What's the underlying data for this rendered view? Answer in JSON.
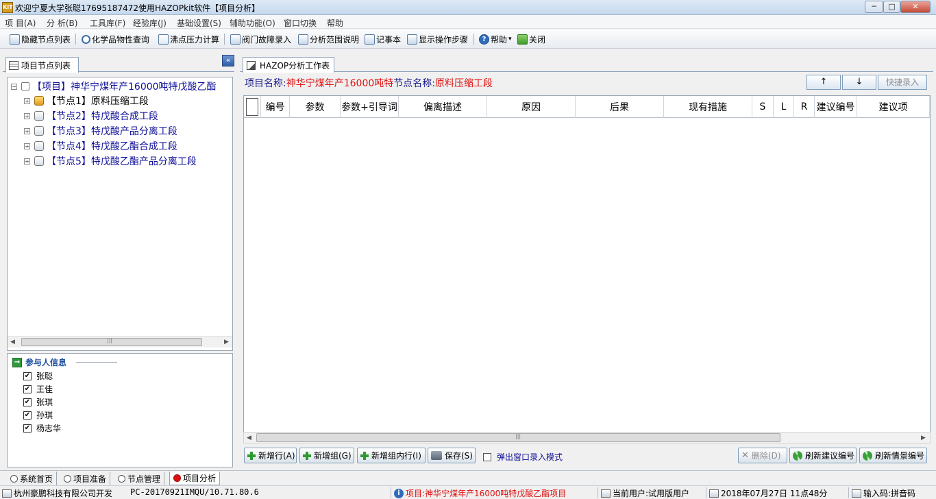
{
  "window": {
    "title": "欢迎宁夏大学张聪17695187472使用HAZOPkit软件【项目分析】",
    "app_icon_text": "KIT",
    "controls": {
      "minimize": "─",
      "maximize": "□",
      "close": "✕"
    }
  },
  "menubar": [
    "项 目(A)",
    "分 析(B)",
    "工具库(F)",
    "经验库(J)",
    "基础设置(S)",
    "辅助功能(O)",
    "窗口切换",
    "帮助"
  ],
  "toolbar": {
    "hide_tree": "隐藏节点列表",
    "chem_query": "化学品物性查询",
    "boiling_calc": "沸点压力计算",
    "valve_fault": "阀门故障录入",
    "scope_desc": "分析范围说明",
    "notepad": "记事本",
    "show_steps": "显示操作步骤",
    "help": "帮助",
    "help_arrow": "▾",
    "close": "关闭"
  },
  "left_panel": {
    "tab_label": "项目节点列表",
    "collapse_symbol": "«",
    "tree": {
      "project": "【项目】神华宁煤年产16000吨特戊酸乙酯",
      "nodes": [
        {
          "label": "【节点1】原料压缩工段",
          "active": true
        },
        {
          "label": "【节点2】特戊酸合成工段",
          "active": false
        },
        {
          "label": "【节点3】特戊酸产品分离工段",
          "active": false
        },
        {
          "label": "【节点4】特戊酸乙酯合成工段",
          "active": false
        },
        {
          "label": "【节点5】特戊酸乙酯产品分离工段",
          "active": false
        }
      ],
      "expander": "⊞",
      "root_expander": "⊟"
    },
    "scroll": {
      "left": "◀",
      "right": "▶",
      "grip": "|||"
    },
    "participants": {
      "title": "参与人信息",
      "people": [
        "张聪",
        "王佳",
        "张琪",
        "孙琪",
        "杨志华"
      ],
      "checkmark": "✔"
    }
  },
  "right_panel": {
    "tab_label": "HAZOP分析工作表",
    "project_label": "项目名称:",
    "project_value": "神华宁煤年产16000吨特",
    "node_label": "节点名称:",
    "node_value": "原料压缩工段",
    "up_button": "↑",
    "down_button": "↓",
    "quick_entry": "快捷录入",
    "columns": [
      "编号",
      "参数",
      "参数+引导词",
      "偏离描述",
      "原因",
      "后果",
      "现有措施",
      "S",
      "L",
      "R",
      "建议编号",
      "建议项"
    ],
    "rows": [],
    "scroll": {
      "left": "◀",
      "right": "▶",
      "grip": "|||"
    }
  },
  "actions": {
    "add_row": "新增行(A)",
    "add_group": "新增组(G)",
    "add_in_group": "新增组内行(I)",
    "save": "保存(S)",
    "popup_mode": "弹出窗口录入模式",
    "delete": "删除(D)",
    "refresh_suggest": "刷新建议编号",
    "refresh_scenario": "刷新情景编号"
  },
  "bottom_tabs": [
    {
      "label": "系统首页",
      "active": false
    },
    {
      "label": "项目准备",
      "active": false
    },
    {
      "label": "节点管理",
      "active": false
    },
    {
      "label": "项目分析",
      "active": true
    }
  ],
  "statusbar": {
    "company": "杭州豪鹏科技有限公司开发",
    "machine": "PC-20170921IMQU/10.71.80.6",
    "project": "项目:神华宁煤年产16000吨特戊酸乙酯项目",
    "user": "当前用户:试用版用户",
    "datetime": "2018年07月27日 11点48分",
    "input": "输入码:拼音码"
  },
  "colors": {
    "accent_red": "#e01010",
    "label_blue": "#1a1a8c",
    "node_blue": "#10109a"
  }
}
